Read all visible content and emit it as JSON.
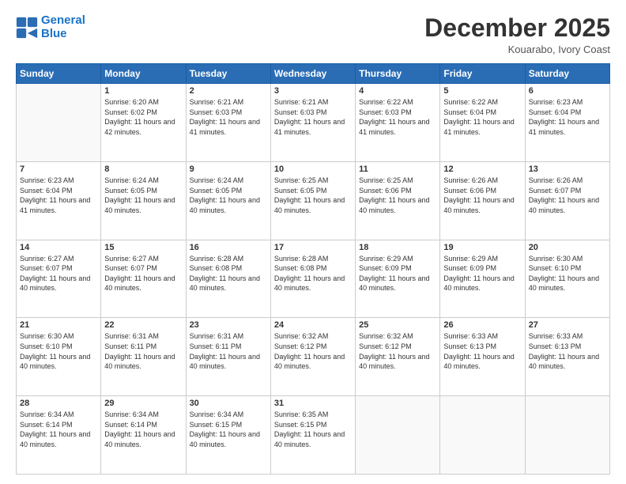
{
  "logo": {
    "line1": "General",
    "line2": "Blue"
  },
  "header": {
    "month": "December 2025",
    "location": "Kouarabo, Ivory Coast"
  },
  "weekdays": [
    "Sunday",
    "Monday",
    "Tuesday",
    "Wednesday",
    "Thursday",
    "Friday",
    "Saturday"
  ],
  "weeks": [
    [
      {
        "day": "",
        "sunrise": "",
        "sunset": "",
        "daylight": "",
        "empty": true
      },
      {
        "day": "1",
        "sunrise": "Sunrise: 6:20 AM",
        "sunset": "Sunset: 6:02 PM",
        "daylight": "Daylight: 11 hours and 42 minutes."
      },
      {
        "day": "2",
        "sunrise": "Sunrise: 6:21 AM",
        "sunset": "Sunset: 6:03 PM",
        "daylight": "Daylight: 11 hours and 41 minutes."
      },
      {
        "day": "3",
        "sunrise": "Sunrise: 6:21 AM",
        "sunset": "Sunset: 6:03 PM",
        "daylight": "Daylight: 11 hours and 41 minutes."
      },
      {
        "day": "4",
        "sunrise": "Sunrise: 6:22 AM",
        "sunset": "Sunset: 6:03 PM",
        "daylight": "Daylight: 11 hours and 41 minutes."
      },
      {
        "day": "5",
        "sunrise": "Sunrise: 6:22 AM",
        "sunset": "Sunset: 6:04 PM",
        "daylight": "Daylight: 11 hours and 41 minutes."
      },
      {
        "day": "6",
        "sunrise": "Sunrise: 6:23 AM",
        "sunset": "Sunset: 6:04 PM",
        "daylight": "Daylight: 11 hours and 41 minutes."
      }
    ],
    [
      {
        "day": "7",
        "sunrise": "Sunrise: 6:23 AM",
        "sunset": "Sunset: 6:04 PM",
        "daylight": "Daylight: 11 hours and 41 minutes."
      },
      {
        "day": "8",
        "sunrise": "Sunrise: 6:24 AM",
        "sunset": "Sunset: 6:05 PM",
        "daylight": "Daylight: 11 hours and 40 minutes."
      },
      {
        "day": "9",
        "sunrise": "Sunrise: 6:24 AM",
        "sunset": "Sunset: 6:05 PM",
        "daylight": "Daylight: 11 hours and 40 minutes."
      },
      {
        "day": "10",
        "sunrise": "Sunrise: 6:25 AM",
        "sunset": "Sunset: 6:05 PM",
        "daylight": "Daylight: 11 hours and 40 minutes."
      },
      {
        "day": "11",
        "sunrise": "Sunrise: 6:25 AM",
        "sunset": "Sunset: 6:06 PM",
        "daylight": "Daylight: 11 hours and 40 minutes."
      },
      {
        "day": "12",
        "sunrise": "Sunrise: 6:26 AM",
        "sunset": "Sunset: 6:06 PM",
        "daylight": "Daylight: 11 hours and 40 minutes."
      },
      {
        "day": "13",
        "sunrise": "Sunrise: 6:26 AM",
        "sunset": "Sunset: 6:07 PM",
        "daylight": "Daylight: 11 hours and 40 minutes."
      }
    ],
    [
      {
        "day": "14",
        "sunrise": "Sunrise: 6:27 AM",
        "sunset": "Sunset: 6:07 PM",
        "daylight": "Daylight: 11 hours and 40 minutes."
      },
      {
        "day": "15",
        "sunrise": "Sunrise: 6:27 AM",
        "sunset": "Sunset: 6:07 PM",
        "daylight": "Daylight: 11 hours and 40 minutes."
      },
      {
        "day": "16",
        "sunrise": "Sunrise: 6:28 AM",
        "sunset": "Sunset: 6:08 PM",
        "daylight": "Daylight: 11 hours and 40 minutes."
      },
      {
        "day": "17",
        "sunrise": "Sunrise: 6:28 AM",
        "sunset": "Sunset: 6:08 PM",
        "daylight": "Daylight: 11 hours and 40 minutes."
      },
      {
        "day": "18",
        "sunrise": "Sunrise: 6:29 AM",
        "sunset": "Sunset: 6:09 PM",
        "daylight": "Daylight: 11 hours and 40 minutes."
      },
      {
        "day": "19",
        "sunrise": "Sunrise: 6:29 AM",
        "sunset": "Sunset: 6:09 PM",
        "daylight": "Daylight: 11 hours and 40 minutes."
      },
      {
        "day": "20",
        "sunrise": "Sunrise: 6:30 AM",
        "sunset": "Sunset: 6:10 PM",
        "daylight": "Daylight: 11 hours and 40 minutes."
      }
    ],
    [
      {
        "day": "21",
        "sunrise": "Sunrise: 6:30 AM",
        "sunset": "Sunset: 6:10 PM",
        "daylight": "Daylight: 11 hours and 40 minutes."
      },
      {
        "day": "22",
        "sunrise": "Sunrise: 6:31 AM",
        "sunset": "Sunset: 6:11 PM",
        "daylight": "Daylight: 11 hours and 40 minutes."
      },
      {
        "day": "23",
        "sunrise": "Sunrise: 6:31 AM",
        "sunset": "Sunset: 6:11 PM",
        "daylight": "Daylight: 11 hours and 40 minutes."
      },
      {
        "day": "24",
        "sunrise": "Sunrise: 6:32 AM",
        "sunset": "Sunset: 6:12 PM",
        "daylight": "Daylight: 11 hours and 40 minutes."
      },
      {
        "day": "25",
        "sunrise": "Sunrise: 6:32 AM",
        "sunset": "Sunset: 6:12 PM",
        "daylight": "Daylight: 11 hours and 40 minutes."
      },
      {
        "day": "26",
        "sunrise": "Sunrise: 6:33 AM",
        "sunset": "Sunset: 6:13 PM",
        "daylight": "Daylight: 11 hours and 40 minutes."
      },
      {
        "day": "27",
        "sunrise": "Sunrise: 6:33 AM",
        "sunset": "Sunset: 6:13 PM",
        "daylight": "Daylight: 11 hours and 40 minutes."
      }
    ],
    [
      {
        "day": "28",
        "sunrise": "Sunrise: 6:34 AM",
        "sunset": "Sunset: 6:14 PM",
        "daylight": "Daylight: 11 hours and 40 minutes."
      },
      {
        "day": "29",
        "sunrise": "Sunrise: 6:34 AM",
        "sunset": "Sunset: 6:14 PM",
        "daylight": "Daylight: 11 hours and 40 minutes."
      },
      {
        "day": "30",
        "sunrise": "Sunrise: 6:34 AM",
        "sunset": "Sunset: 6:15 PM",
        "daylight": "Daylight: 11 hours and 40 minutes."
      },
      {
        "day": "31",
        "sunrise": "Sunrise: 6:35 AM",
        "sunset": "Sunset: 6:15 PM",
        "daylight": "Daylight: 11 hours and 40 minutes."
      },
      {
        "day": "",
        "sunrise": "",
        "sunset": "",
        "daylight": "",
        "empty": true
      },
      {
        "day": "",
        "sunrise": "",
        "sunset": "",
        "daylight": "",
        "empty": true
      },
      {
        "day": "",
        "sunrise": "",
        "sunset": "",
        "daylight": "",
        "empty": true
      }
    ]
  ]
}
